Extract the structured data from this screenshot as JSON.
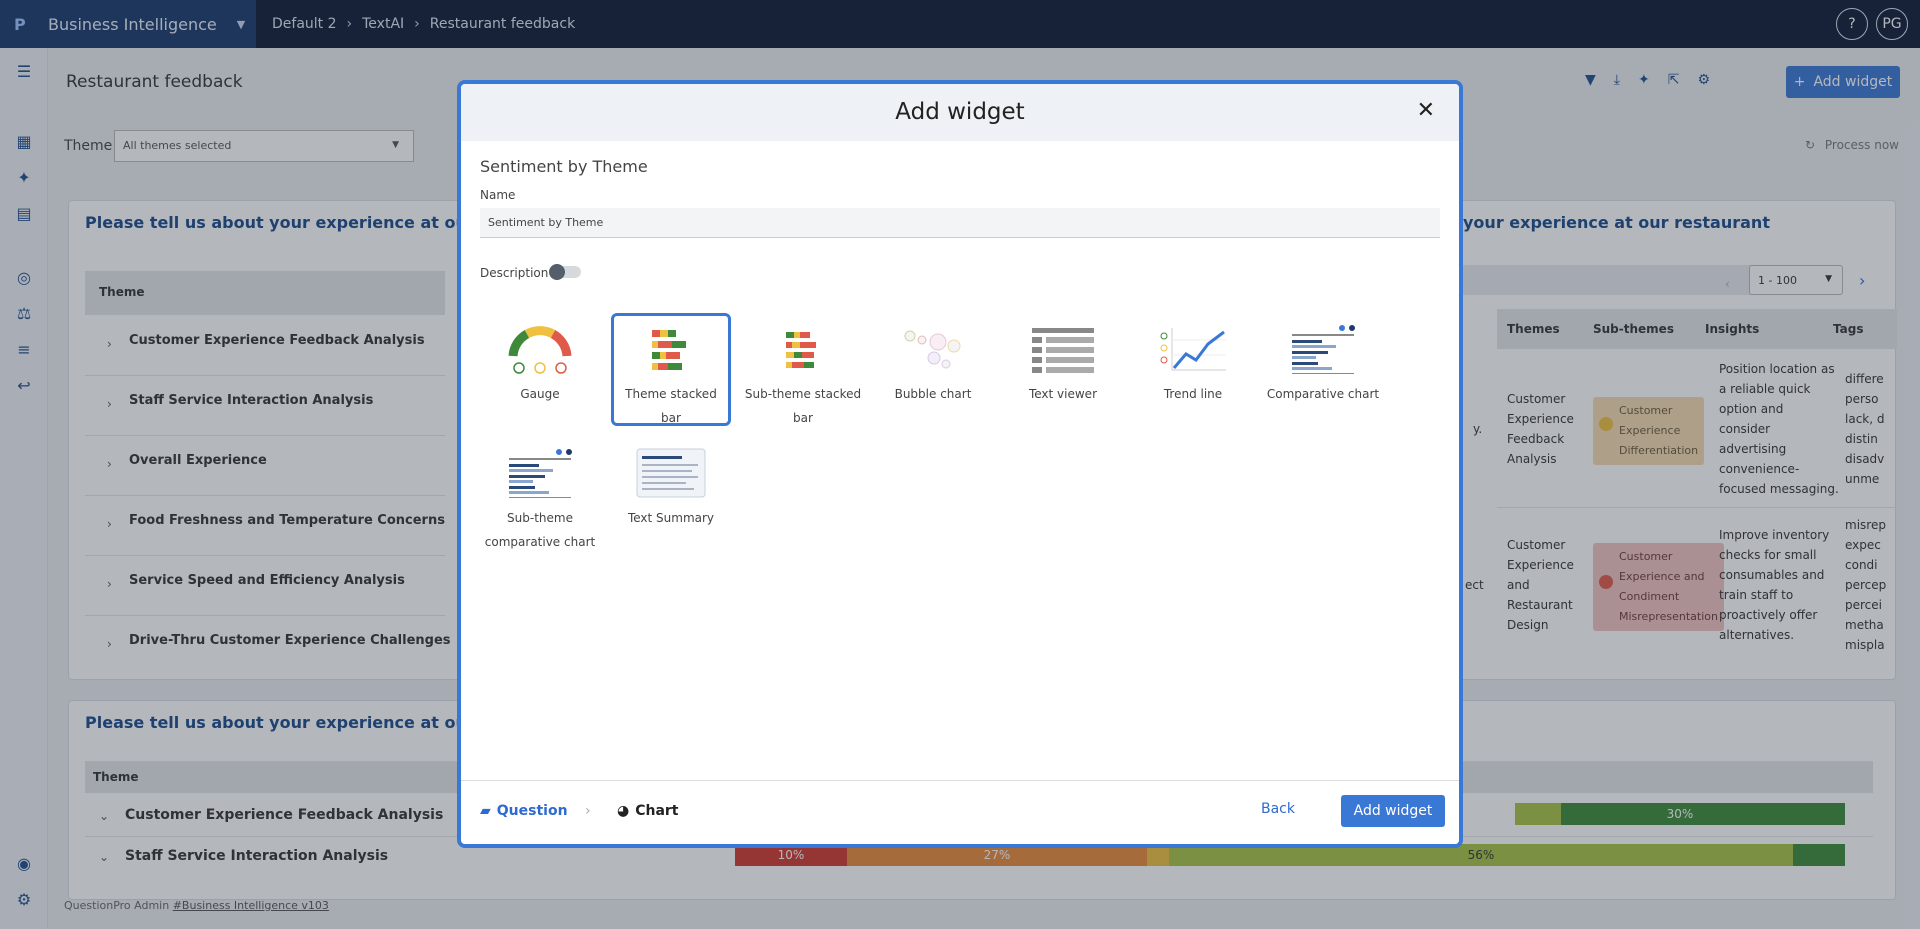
{
  "topbar": {
    "brand": "Business Intelligence",
    "breadcrumbs": [
      "Default 2",
      "TextAI",
      "Restaurant feedback"
    ],
    "help": "?",
    "avatar": "PG"
  },
  "page": {
    "title": "Restaurant feedback",
    "add_widget": "Add widget",
    "theme_label": "Theme",
    "theme_select": "All themes selected",
    "process_now": "Process now",
    "panel1_title": "Please tell us about your experience at our restaura",
    "panel1_title_right": "your experience at our restaurant",
    "theme_col": "Theme",
    "themes": [
      "Customer Experience Feedback Analysis",
      "Staff Service Interaction Analysis",
      "Overall Experience",
      "Food Freshness and Temperature Concerns",
      "Service Speed and Efficiency Analysis",
      "Drive-Thru Customer Experience Challenges"
    ],
    "pager": "1 - 100",
    "right_cols": [
      "Themes",
      "Sub-themes",
      "Insights",
      "Tags"
    ],
    "right_rows": [
      {
        "fragment": "y.",
        "theme": [
          "Customer",
          "Experience",
          "Feedback",
          "Analysis"
        ],
        "subtheme": [
          "Customer",
          "Experience",
          "Differentiation"
        ],
        "insight": [
          "Position location as",
          "a reliable quick",
          "option and",
          "consider",
          "advertising",
          "convenience-",
          "focused messaging."
        ],
        "tags": [
          "differe",
          "perso",
          "lack, d",
          "distin",
          "disadv",
          "unme"
        ]
      },
      {
        "fragment": "ect",
        "theme": [
          "Customer",
          "Experience",
          "and",
          "Restaurant",
          "Design"
        ],
        "subtheme": [
          "Customer",
          "Experience and",
          "Condiment",
          "Misrepresentation"
        ],
        "insight": [
          "Improve inventory",
          "checks for small",
          "consumables and",
          "train staff to",
          "proactively offer",
          "alternatives."
        ],
        "tags": [
          "misrep",
          "expec",
          "condi",
          "percep",
          "percei",
          "metha",
          "mispla"
        ]
      }
    ],
    "panel2_title": "Please tell us about your experience at our restaura",
    "panel2_theme_col": "Theme",
    "panel2_rows": [
      "Customer Experience Feedback Analysis",
      "Staff Service Interaction Analysis"
    ],
    "bar1_label": "30%",
    "bar2_labels": [
      "10%",
      "27%",
      "56%"
    ],
    "footer_text": "QuestionPro Admin ",
    "footer_link": "#Business Intelligence v103"
  },
  "modal": {
    "title": "Add widget",
    "close": "✕",
    "heading": "Sentiment by Theme",
    "name_label": "Name",
    "name_value": "Sentiment by Theme",
    "description_label": "Description",
    "widgets": [
      {
        "label": "Gauge",
        "icon": "gauge-icon",
        "selected": false
      },
      {
        "label": "Theme stacked bar",
        "icon": "theme-stacked-bar-icon",
        "selected": true
      },
      {
        "label": "Sub-theme stacked bar",
        "icon": "sub-theme-stacked-bar-icon",
        "selected": false
      },
      {
        "label": "Bubble chart",
        "icon": "bubble-chart-icon",
        "selected": false
      },
      {
        "label": "Text viewer",
        "icon": "text-viewer-icon",
        "selected": false
      },
      {
        "label": "Trend line",
        "icon": "trend-line-icon",
        "selected": false
      },
      {
        "label": "Comparative chart",
        "icon": "comparative-chart-icon",
        "selected": false
      },
      {
        "label": "Sub-theme comparative chart",
        "icon": "sub-theme-comparative-chart-icon",
        "selected": false
      },
      {
        "label": "Text Summary",
        "icon": "text-summary-icon",
        "selected": false
      }
    ],
    "step_question": "Question",
    "step_chart": "Chart",
    "back": "Back",
    "add": "Add widget"
  },
  "colors": {
    "accent": "#3a78d6",
    "navy": "#0e1a33",
    "brand_bg": "#1a3a6b",
    "positive": "#4a9a3c",
    "neutral": "#f0c040",
    "negative": "#e05a4a"
  }
}
